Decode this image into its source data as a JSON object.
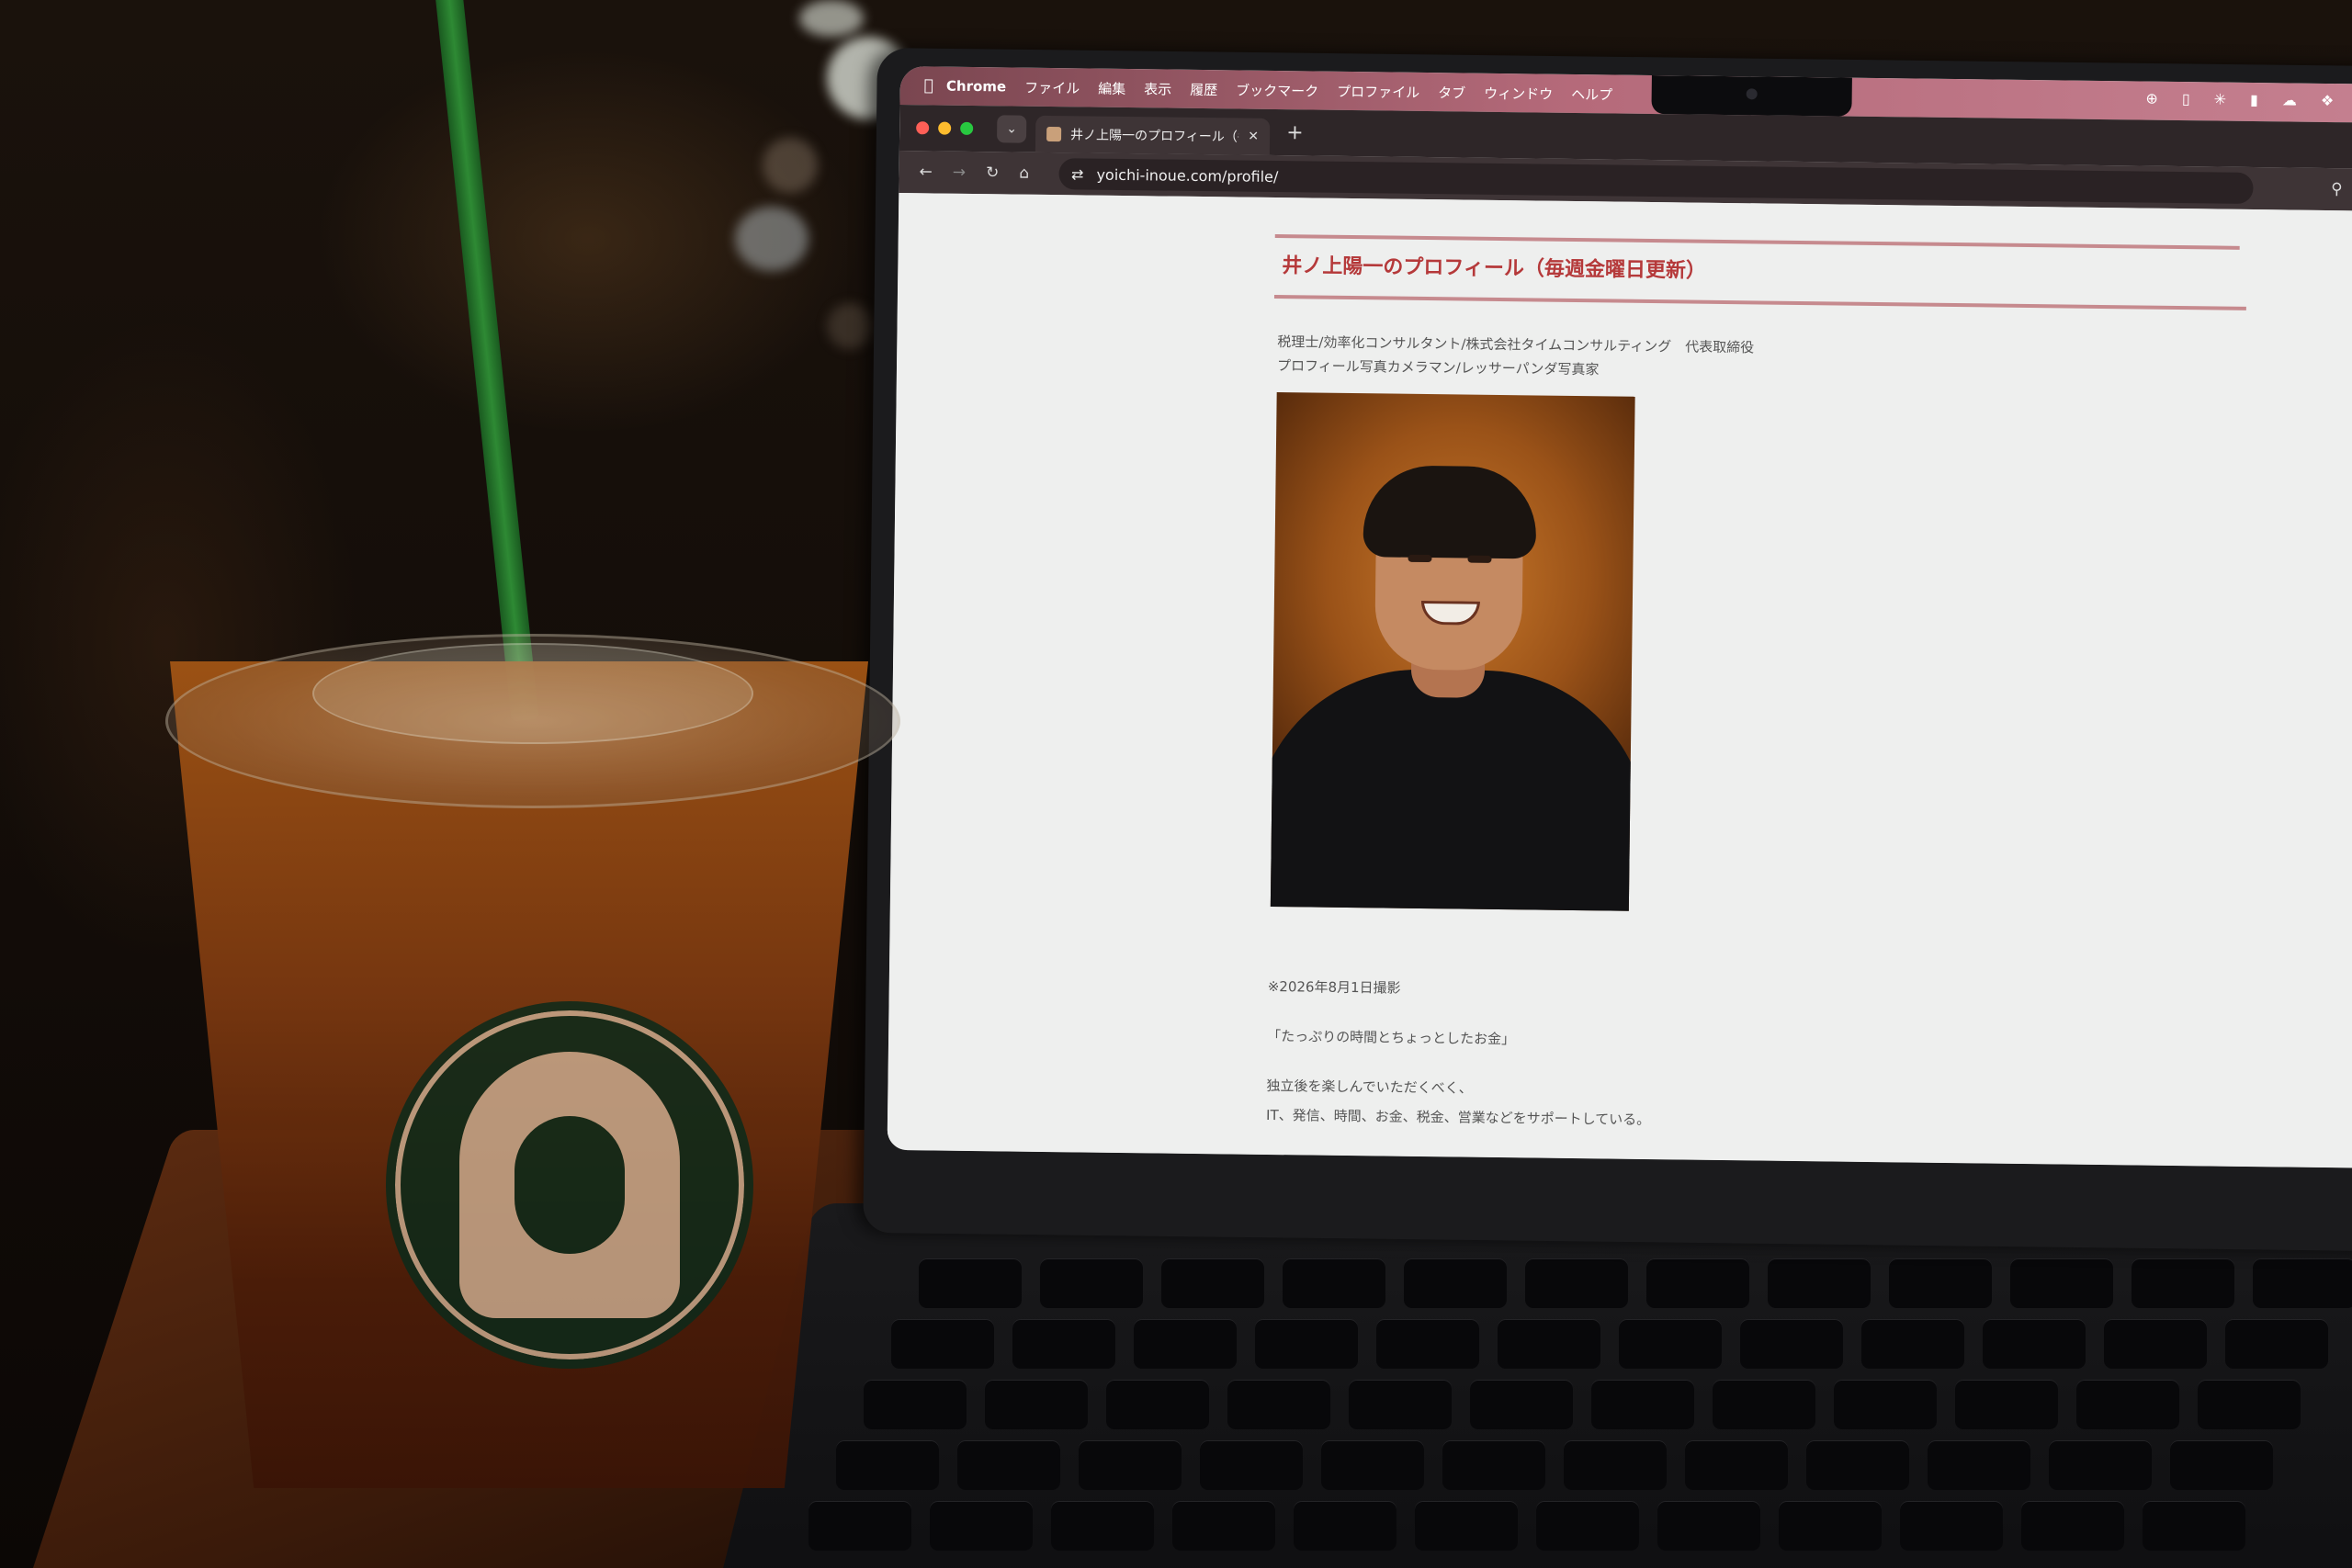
{
  "menubar": {
    "app": "Chrome",
    "items": [
      "ファイル",
      "編集",
      "表示",
      "履歴",
      "ブックマーク",
      "プロファイル",
      "タブ",
      "ウィンドウ",
      "ヘルプ"
    ]
  },
  "browser": {
    "tab_title": "井ノ上陽一のプロフィール（毎週",
    "url": "yoichi-inoue.com/profile/"
  },
  "page": {
    "title": "井ノ上陽一のプロフィール（毎週金曜日更新）",
    "subtitle_line1": "税理士/効率化コンサルタント/株式会社タイムコンサルティング　代表取締役",
    "subtitle_line2": "プロフィール写真カメラマン/レッサーパンダ写真家",
    "photo_caption": "※2026年8月1日撮影",
    "quote": "「たっぷりの時間とちょっとしたお金」",
    "body_line1": "独立後を楽しんでいただくべく、",
    "body_line2": "IT、発信、時間、お金、税金、営業などをサポートしている。"
  },
  "colors": {
    "title_red": "#b5393a",
    "rule_pink": "#c68a8e",
    "menubar_accent": "#b56a7a",
    "straw_green": "#2e8a34"
  }
}
